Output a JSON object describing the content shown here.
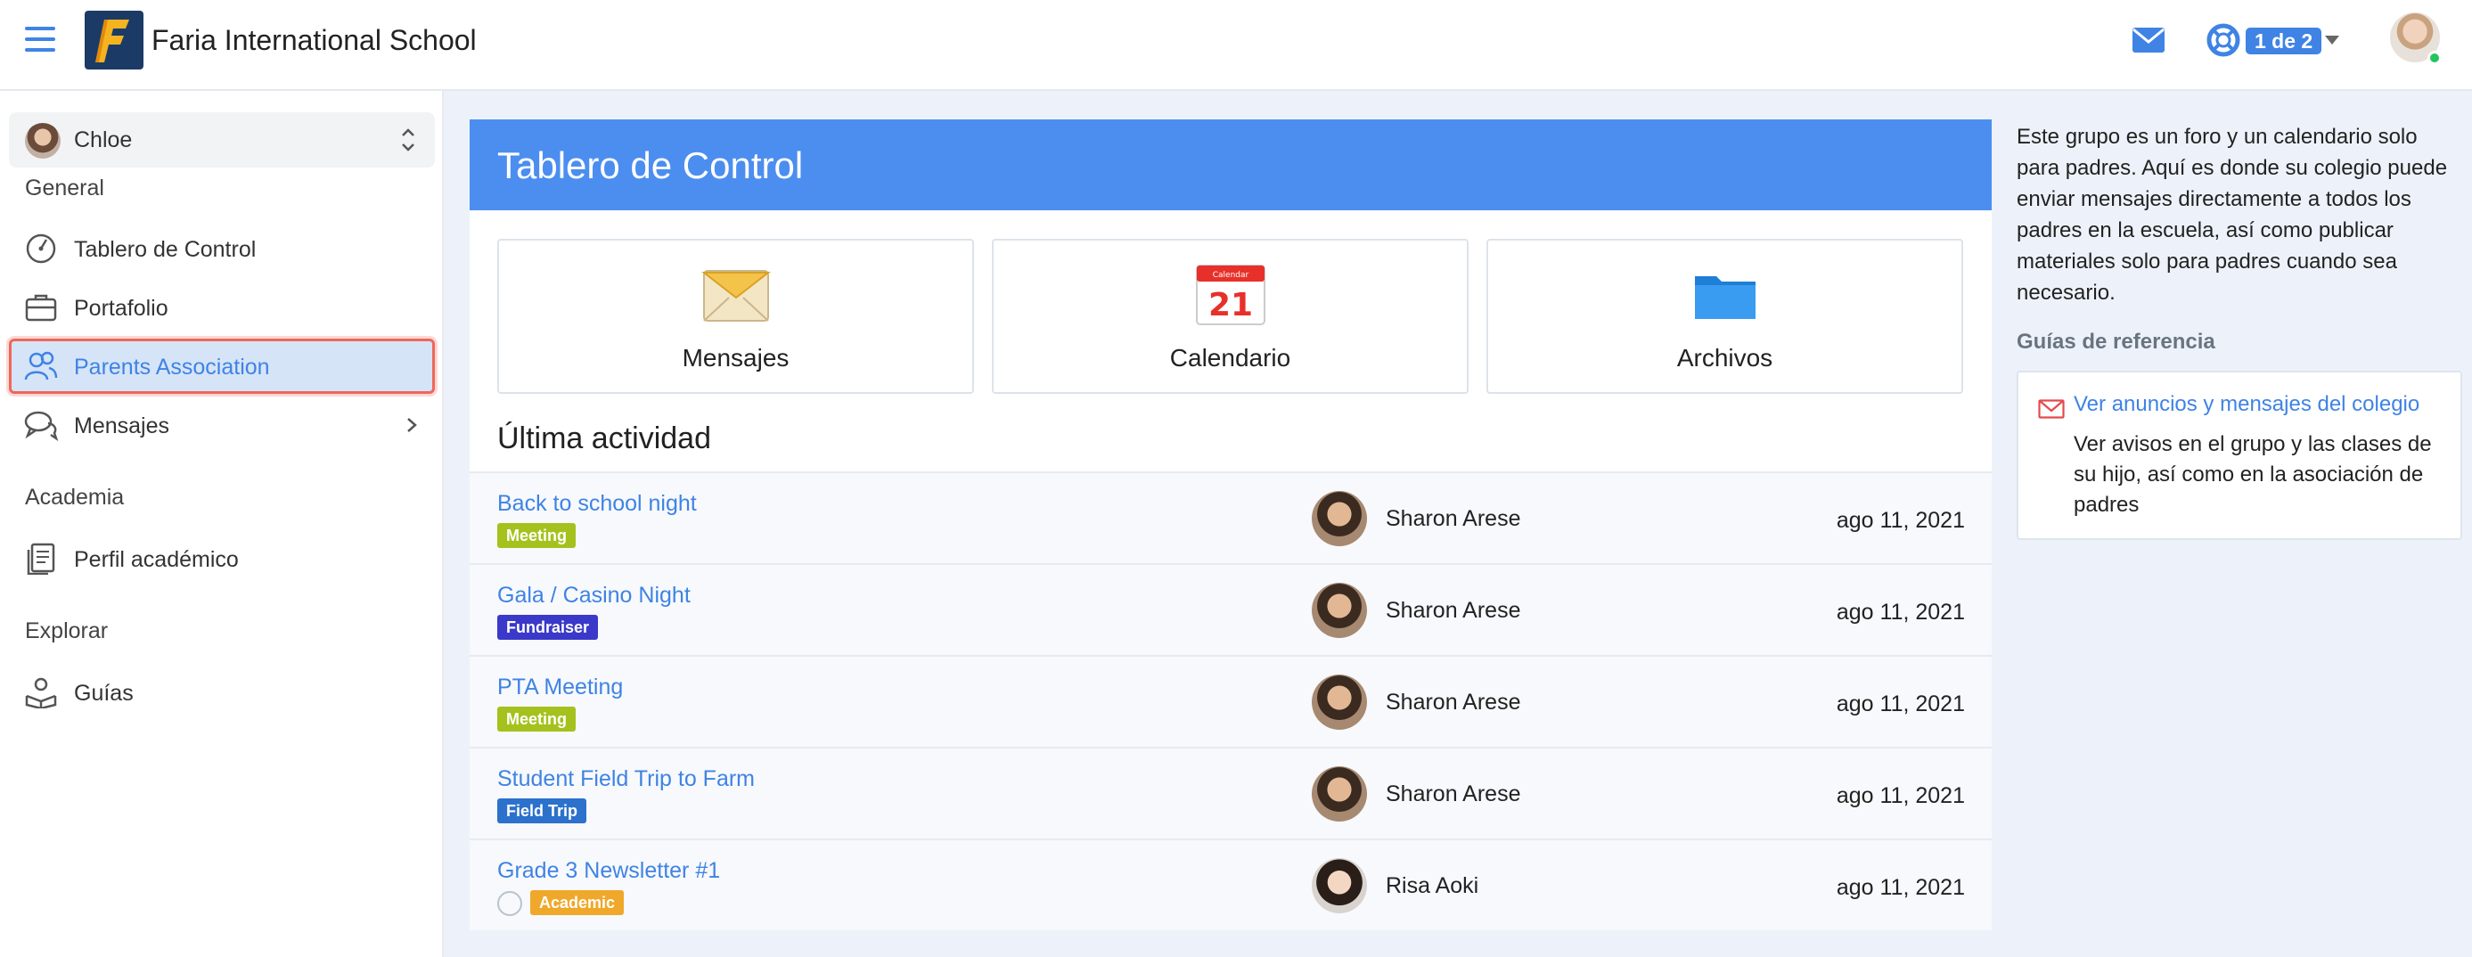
{
  "topbar": {
    "school_name": "Faria International School",
    "page_indicator": "1 de 2"
  },
  "sidebar": {
    "child_name": "Chloe",
    "sections": [
      {
        "label": "General"
      },
      {
        "label": "Academia"
      },
      {
        "label": "Explorar"
      }
    ],
    "items": [
      {
        "label": "Tablero de Control",
        "icon": "dashboard-icon"
      },
      {
        "label": "Portafolio",
        "icon": "briefcase-icon"
      },
      {
        "label": "Parents Association",
        "icon": "group-icon",
        "active": true
      },
      {
        "label": "Mensajes",
        "icon": "chat-icon"
      },
      {
        "label": "Perfil académico",
        "icon": "document-icon"
      },
      {
        "label": "Guías",
        "icon": "guides-icon"
      }
    ]
  },
  "main": {
    "title": "Tablero de Control",
    "tiles": [
      {
        "label": "Mensajes",
        "icon": "envelope-icon"
      },
      {
        "label": "Calendario",
        "icon": "calendar-icon",
        "icon_small_text": "Calendar",
        "icon_number": "21"
      },
      {
        "label": "Archivos",
        "icon": "folder-icon"
      }
    ],
    "activity_title": "Última actividad",
    "activity": [
      {
        "title": "Back to school night",
        "tag": "Meeting",
        "tag_color": "#a3c21d",
        "author": "Sharon Arese",
        "date": "ago 11, 2021"
      },
      {
        "title": "Gala / Casino Night",
        "tag": "Fundraiser",
        "tag_color": "#3b39c9",
        "author": "Sharon Arese",
        "date": "ago 11, 2021"
      },
      {
        "title": "PTA Meeting",
        "tag": "Meeting",
        "tag_color": "#a3c21d",
        "author": "Sharon Arese",
        "date": "ago 11, 2021"
      },
      {
        "title": "Student Field Trip to Farm",
        "tag": "Field Trip",
        "tag_color": "#2c71cc",
        "author": "Sharon Arese",
        "date": "ago 11, 2021"
      },
      {
        "title": "Grade 3 Newsletter #1",
        "tag": "Academic",
        "tag_color": "#f0a82a",
        "author": "Risa Aoki",
        "date": "ago 11, 2021"
      }
    ]
  },
  "right": {
    "info": "Este grupo es un foro y un calendario solo para padres. Aquí es donde su colegio puede enviar mensajes directamente a todos los padres en la escuela, así como publicar materiales solo para padres cuando sea necesario.",
    "guides_title": "Guías de referencia",
    "guide_link": "Ver anuncios y mensajes del colegio",
    "guide_desc": "Ver avisos en el grupo y las clases de su hijo, así como en la asociación de padres"
  },
  "colors": {
    "accent": "#3f83e4",
    "header_blue": "#4c8ef0",
    "highlight_border": "#f06759"
  }
}
